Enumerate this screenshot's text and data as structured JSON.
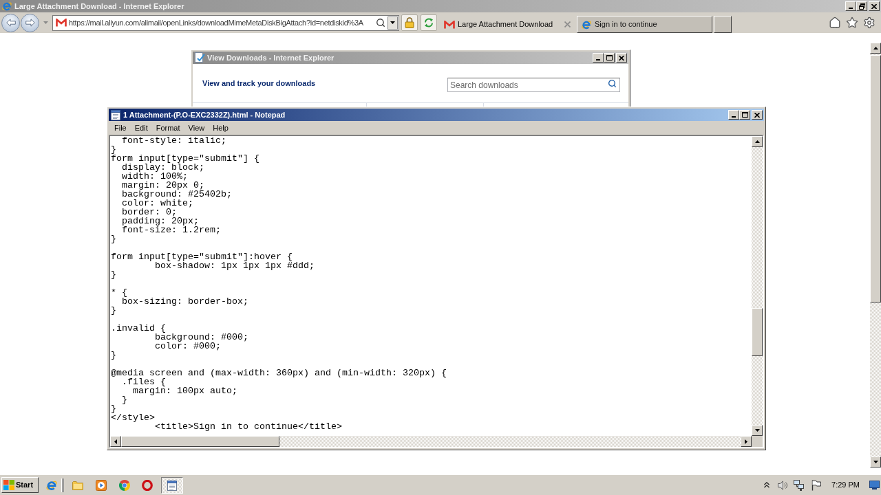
{
  "browser": {
    "title": "Large Attachment Download - Internet Explorer",
    "active": false,
    "address": "https://mail.aliyun.com/alimail/openLinks/downloadMimeMetaDiskBigAttach?id=netdiskid%3A",
    "tabs": [
      {
        "label": "Large Attachment Download",
        "selected": true
      },
      {
        "label": "Sign in to continue",
        "selected": false
      }
    ]
  },
  "downloads_window": {
    "title": "View Downloads - Internet Explorer",
    "active": false,
    "heading": "View and track your downloads",
    "search": {
      "placeholder": "Search downloads"
    }
  },
  "notepad": {
    "title": "1 Attachment-(P.O-EXC2332Z).html - Notepad",
    "active": true,
    "menu": [
      "File",
      "Edit",
      "Format",
      "View",
      "Help"
    ],
    "blocks": [
      {
        "lines": [
          "  font-style: italic;",
          "}",
          "form input[type=\"submit\"] {",
          "  display: block;",
          "  width: 100%;",
          "  margin: 20px 0;",
          "  background: #25402b;",
          "  color: white;",
          "  border: 0;",
          "  padding: 20px;",
          "  font-size: 1.2rem;",
          "}"
        ]
      },
      {
        "lines": [
          "form input[type=\"submit\"]:hover {",
          "        box-shadow: 1px 1px 1px #ddd;",
          "}"
        ]
      },
      {
        "lines": [
          "* {",
          "  box-sizing: border-box;",
          "}"
        ]
      },
      {
        "lines": [
          ".invalid {",
          "        background: #000;",
          "        color: #000;",
          "}"
        ]
      },
      {
        "lines": [
          "@media screen and (max-width: 360px) and (min-width: 320px) {",
          "  .files {",
          "    margin: 100px auto;",
          "  }",
          "}",
          "</style>",
          "        <title>Sign in to continue</title>"
        ]
      }
    ]
  },
  "taskbar": {
    "start": "Start",
    "clock": "7:29 PM"
  }
}
